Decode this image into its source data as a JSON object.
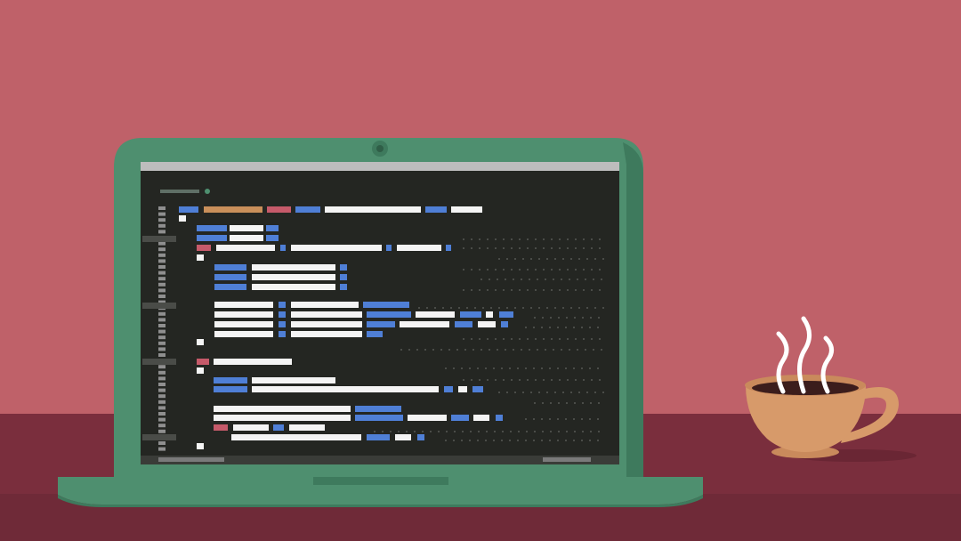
{
  "scene": {
    "description_visible_text": "",
    "palette": {
      "wall": "#BF6169",
      "desk": "#7A2E3D",
      "desk_shadow": "#6A2634",
      "laptop_body": "#4E8F6F",
      "laptop_body_dark": "#3E7A5D",
      "screen_bg": "#242622",
      "screen_bar": "#BDBDBD",
      "code_blue": "#4F7FD6",
      "code_white": "#F4F4F4",
      "code_orange": "#C98F5A",
      "code_pink": "#C65A6A",
      "gutter": "#8F8F8F",
      "cup": "#D79A6A",
      "cup_dark": "#C98A5C",
      "coffee": "#3B1D1C",
      "steam": "#FFFFFF"
    },
    "icons": [
      "laptop-icon",
      "coffee-cup-icon",
      "steam-icon",
      "webcam-icon"
    ]
  }
}
